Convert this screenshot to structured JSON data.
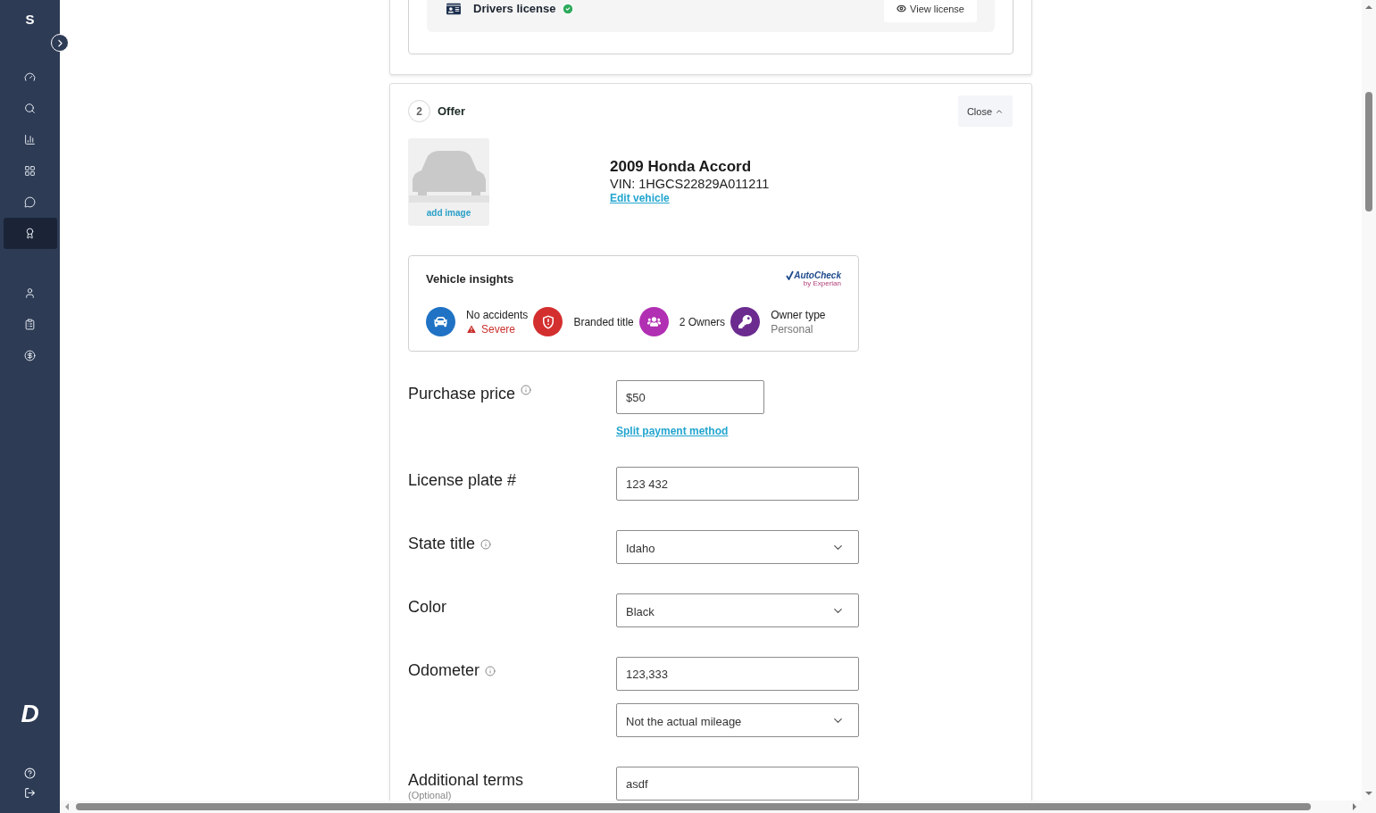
{
  "sidebar": {
    "brand": "S",
    "nav_main": [
      {
        "selected": false
      },
      {
        "selected": false
      },
      {
        "selected": false
      },
      {
        "selected": false
      },
      {
        "selected": false
      },
      {
        "selected": true
      }
    ],
    "nav_account": [
      {
        "selected": false
      },
      {
        "selected": false
      },
      {
        "selected": false
      }
    ],
    "logo": "D"
  },
  "license_card": {
    "label": "Drivers license",
    "verified": true,
    "button": "View license"
  },
  "offer": {
    "step": "2",
    "title": "Offer",
    "close_button": "Close",
    "vehicle": {
      "image_action": "add image",
      "title": "2009 Honda Accord",
      "vin": "VIN: 1HGCS22829A011211",
      "edit_link": "Edit vehicle"
    },
    "insights": {
      "title": "Vehicle insights",
      "logo": "AutoCheck",
      "logo_sub": "by Experian",
      "items": [
        {
          "title": "No accidents",
          "detail": "Severe",
          "kind": "warning",
          "color": "#1f72c4"
        },
        {
          "title": "Branded title",
          "kind": "plain",
          "color": "#d42f2f"
        },
        {
          "title": "2 Owners",
          "kind": "plain",
          "color": "#b12fb3"
        },
        {
          "title": "Owner type",
          "detail": "Personal",
          "kind": "detail",
          "color": "#6b2b8f"
        }
      ]
    },
    "form": [
      {
        "label": "Purchase price",
        "info": true,
        "fields": [
          {
            "kind": "amount",
            "value": "$50"
          }
        ],
        "link": "Split payment method"
      },
      {
        "label": "License plate #",
        "info": false,
        "fields": [
          {
            "kind": "input",
            "value": "123 432"
          }
        ]
      },
      {
        "label": "State title",
        "info": true,
        "fields": [
          {
            "kind": "select",
            "value": "Idaho"
          }
        ]
      },
      {
        "label": "Color",
        "info": false,
        "fields": [
          {
            "kind": "select",
            "value": "Black"
          }
        ]
      },
      {
        "label": "Odometer",
        "info": true,
        "fields": [
          {
            "kind": "input",
            "value": "123,333"
          },
          {
            "kind": "select",
            "value": "Not the actual mileage"
          }
        ]
      },
      {
        "label": "Additional terms",
        "note": "(Optional)",
        "info": false,
        "fields": [
          {
            "kind": "input",
            "value": "asdf"
          }
        ]
      }
    ]
  }
}
